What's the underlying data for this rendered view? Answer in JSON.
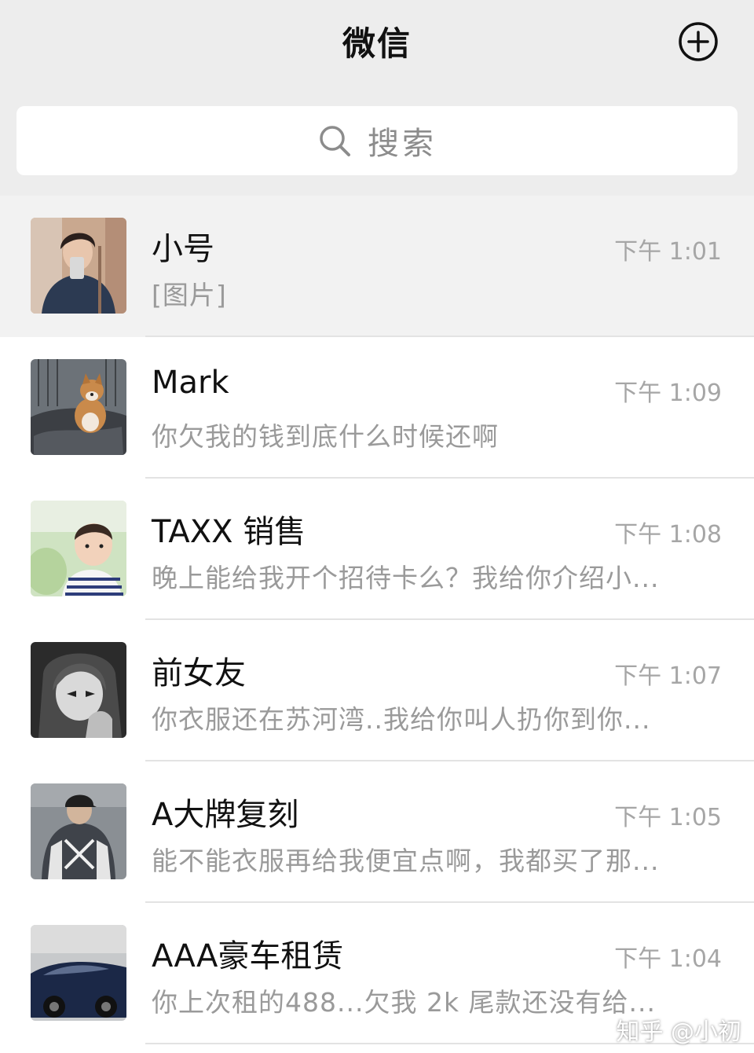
{
  "header": {
    "title": "微信",
    "add_icon": "plus-circle-icon"
  },
  "search": {
    "icon": "search-icon",
    "placeholder": "搜索"
  },
  "chats": [
    {
      "name": "小号",
      "time": "下午 1:01",
      "preview": "[图片]",
      "pinned": true,
      "avatar": "selfie-man-avatar"
    },
    {
      "name": "Mark",
      "time": "下午 1:09",
      "preview": "你欠我的钱到底什么时候还啊",
      "avatar": "shiba-dog-avatar"
    },
    {
      "name": "TAXX 销售",
      "time": "下午 1:08",
      "preview": "晚上能给我开个招待卡么？我给你介绍小...",
      "avatar": "baby-avatar"
    },
    {
      "name": "前女友",
      "time": "下午 1:07",
      "preview": "你衣服还在苏河湾..我给你叫人扔你到你...",
      "avatar": "anime-girl-avatar"
    },
    {
      "name": "A大牌复刻",
      "time": "下午 1:05",
      "preview": "能不能衣服再给我便宜点啊，我都买了那...",
      "avatar": "man-back-avatar"
    },
    {
      "name": "AAA豪车租赁",
      "time": "下午 1:04",
      "preview": "你上次租的488...欠我 2k 尾款还没有给...",
      "avatar": "sports-car-avatar"
    }
  ],
  "watermark": "知乎 @小初"
}
